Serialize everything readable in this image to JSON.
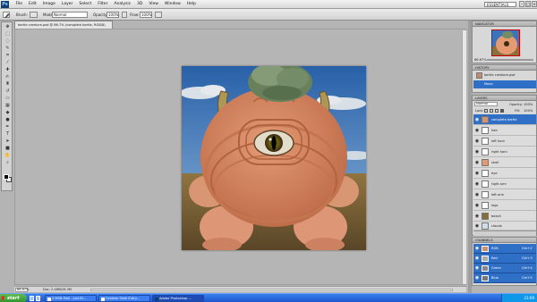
{
  "app": {
    "logo": "Ps",
    "workspace": "ESSENTIALS"
  },
  "menus": [
    "File",
    "Edit",
    "Image",
    "Layer",
    "Select",
    "Filter",
    "Analysis",
    "3D",
    "View",
    "Window",
    "Help"
  ],
  "window_buttons": [
    "–",
    "□",
    "×"
  ],
  "options": {
    "brush_label": "Brush:",
    "mode_label": "Mode:",
    "mode_value": "Normal",
    "opacity_label": "Opacity:",
    "opacity_value": "100%",
    "flow_label": "Flow:",
    "flow_value": "100%"
  },
  "document": {
    "tab_title": "bertie creature.psd @ 66.7% (complete bertie, RGB/8)"
  },
  "status": {
    "zoom": "66.67%",
    "doc_size": "Doc: 2.48M/26.3M"
  },
  "navigator": {
    "tab": "NAVIGATOR",
    "zoom": "66.67%"
  },
  "history": {
    "tab": "HISTORY",
    "items": [
      "bertie creature.psd",
      "Move"
    ]
  },
  "layers": {
    "tab": "LAYERS",
    "blend_mode": "Normal",
    "opacity_label": "Opacity:",
    "opacity_value": "100%",
    "lock_label": "Lock:",
    "fill_label": "Fill:",
    "fill_value": "100%",
    "items": [
      {
        "name": "complete bertie",
        "selected": true
      },
      {
        "name": "hair"
      },
      {
        "name": "left horn"
      },
      {
        "name": "right horn"
      },
      {
        "name": "shell"
      },
      {
        "name": "eye"
      },
      {
        "name": "right arm"
      },
      {
        "name": "left arm"
      },
      {
        "name": "legs"
      },
      {
        "name": "beach"
      },
      {
        "name": "clouds"
      }
    ]
  },
  "channels": {
    "tab": "CHANNELS",
    "items": [
      {
        "name": "RGB",
        "key": "Ctrl+2"
      },
      {
        "name": "Red",
        "key": "Ctrl+3"
      },
      {
        "name": "Green",
        "key": "Ctrl+4"
      },
      {
        "name": "Blue",
        "key": "Ctrl+5"
      }
    ]
  },
  "taskbar": {
    "start": "start",
    "buttons": [
      "2 MSN Mail - Just Bl...",
      "October Shell Entry...",
      "Adobe Photoshop ..."
    ],
    "clock": "23:09"
  },
  "colors": {
    "selection": "#2f6fc6",
    "taskbar": "#2a63d9"
  }
}
